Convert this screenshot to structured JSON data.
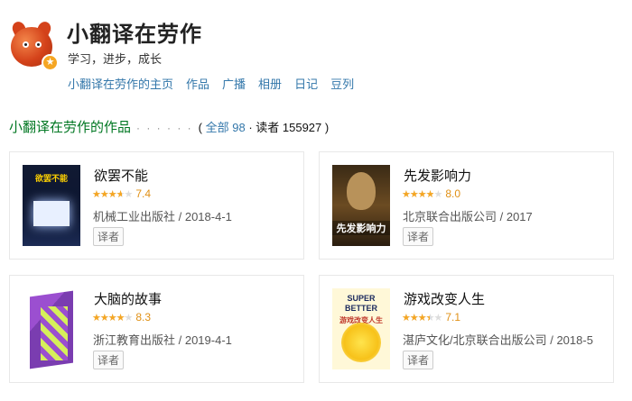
{
  "profile": {
    "name": "小翻译在劳作",
    "motto": "学习，进步，成长",
    "badge_icon": "star-icon"
  },
  "nav": {
    "items": [
      "小翻译在劳作的主页",
      "作品",
      "广播",
      "相册",
      "日记",
      "豆列"
    ]
  },
  "section": {
    "title": "小翻译在劳作的作品",
    "dots": "· · · · · ·",
    "open_paren": "( ",
    "all_label": "全部 98",
    "separator": " · ",
    "readers_label": "读者 155927",
    "close_paren": " )"
  },
  "books": [
    {
      "title": "欲罢不能",
      "rating": "7.4",
      "rating_fraction": 0.74,
      "publisher": "机械工业出版社 / 2018-4-1",
      "role": "译者",
      "cover_text": "欲罢不能"
    },
    {
      "title": "先发影响力",
      "rating": "8.0",
      "rating_fraction": 0.8,
      "publisher": "北京联合出版公司 / 2017",
      "role": "译者",
      "cover_text": "先发影响力"
    },
    {
      "title": "大脑的故事",
      "rating": "8.3",
      "rating_fraction": 0.83,
      "publisher": "浙江教育出版社 / 2019-4-1",
      "role": "译者"
    },
    {
      "title": "游戏改变人生",
      "rating": "7.1",
      "rating_fraction": 0.71,
      "publisher": "湛庐文化/北京联合出版公司 / 2018-5",
      "role": "译者",
      "cover_text": "SUPER BETTER",
      "cover_subtext": "游戏改变人生"
    }
  ],
  "colors": {
    "link": "#3377aa",
    "section_title": "#007722",
    "star": "#f5a623",
    "score": "#e09015"
  }
}
